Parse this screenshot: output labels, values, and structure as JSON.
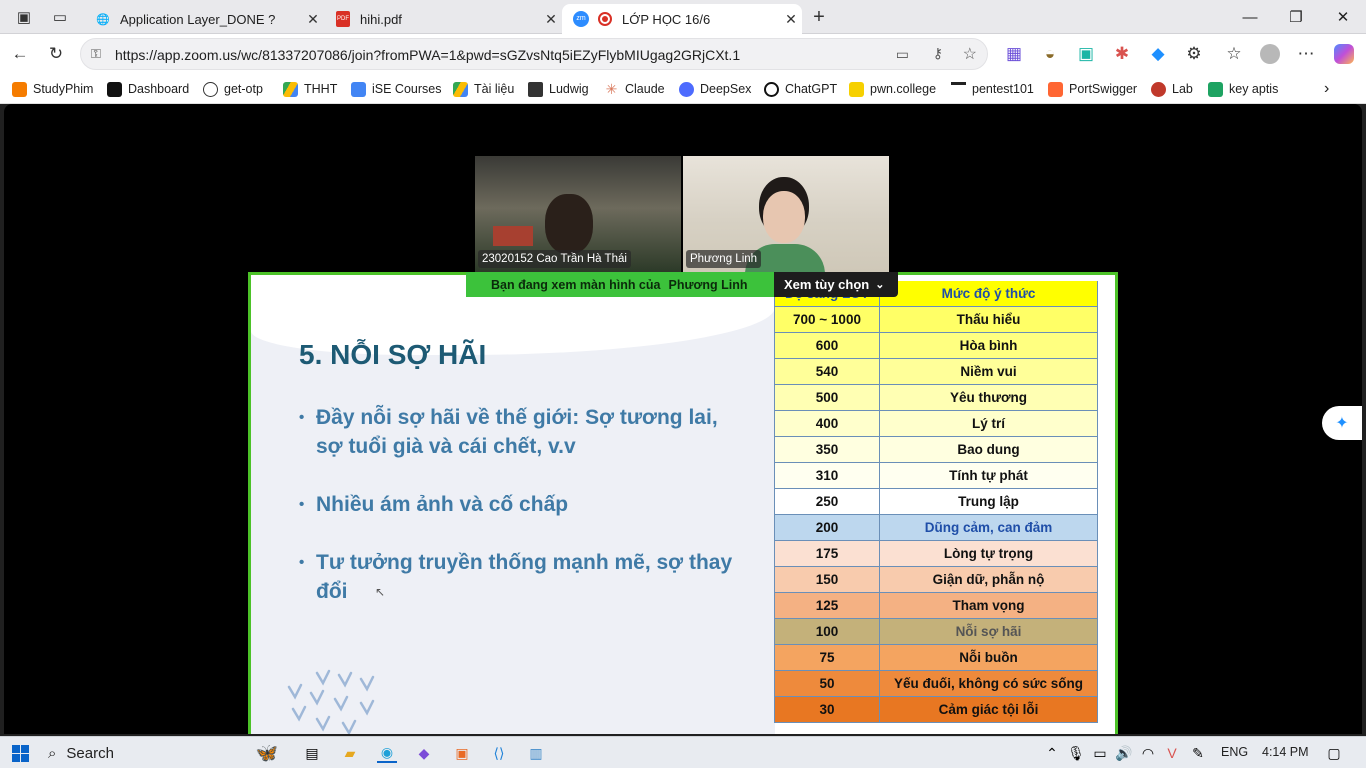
{
  "browser": {
    "tabs": [
      {
        "title": "Application Layer_DONE ?",
        "icon": "globe-icon"
      },
      {
        "title": "hihi.pdf",
        "icon": "pdf-icon"
      },
      {
        "title": "LỚP HỌC 16/6",
        "icon": "zoom-icon",
        "active": true
      }
    ],
    "url": "https://app.zoom.us/wc/81337207086/join?fromPWA=1&pwd=sGZvsNtq5iEZyFlybMIUgag2GRjCXt.1",
    "bookmarks": [
      "StudyPhim",
      "Dashboard",
      "get-otp",
      "THHT",
      "iSE Courses",
      "Tài liệu",
      "Ludwig",
      "Claude",
      "DeepSex",
      "ChatGPT",
      "pwn.college",
      "pentest101",
      "PortSwigger",
      "Lab",
      "key aptis"
    ]
  },
  "zoom": {
    "participants": [
      "23020152 Cao Trần Hà Thái",
      "Phương Linh"
    ],
    "share_banner": "Bạn đang xem màn hình của",
    "share_owner": "Phương Linh",
    "view_options": "Xem tùy chọn"
  },
  "slide": {
    "title": "5. NỖI SỢ HÃI",
    "bullets": [
      "Đầy nỗi sợ hãi về thế giới: Sợ tương lai, sợ tuổi già và cái chết, v.v",
      "Nhiều ám ảnh và cố chấp",
      "Tư tưởng truyền thống mạnh mẽ, sợ thay đổi"
    ],
    "table": {
      "headers": [
        "Độ sáng LOT",
        "Mức độ ý thức"
      ],
      "rows": [
        {
          "value": "700 ~ 1000",
          "label": "Thấu hiểu",
          "color": "#ffff66"
        },
        {
          "value": "600",
          "label": "Hòa bình",
          "color": "#ffff80"
        },
        {
          "value": "540",
          "label": "Niềm vui",
          "color": "#ffff99"
        },
        {
          "value": "500",
          "label": "Yêu thương",
          "color": "#ffffb3"
        },
        {
          "value": "400",
          "label": "Lý trí",
          "color": "#ffffcc"
        },
        {
          "value": "350",
          "label": "Bao dung",
          "color": "#ffffe0"
        },
        {
          "value": "310",
          "label": "Tính tự phát",
          "color": "#fffff0"
        },
        {
          "value": "250",
          "label": "Trung lập",
          "color": "#ffffff"
        },
        {
          "value": "200",
          "label": "Dũng cảm, can đảm",
          "color": "#bdd7ee",
          "text": "#1f4ea8"
        },
        {
          "value": "175",
          "label": "Lòng tự trọng",
          "color": "#fbe0d2"
        },
        {
          "value": "150",
          "label": "Giận dữ, phẫn nộ",
          "color": "#f8cbad"
        },
        {
          "value": "125",
          "label": "Tham vọng",
          "color": "#f4b183"
        },
        {
          "value": "100",
          "label": "Nỗi sợ hãi",
          "color": "#c4b17a",
          "text": "#555"
        },
        {
          "value": "75",
          "label": "Nỗi buồn",
          "color": "#f4a460"
        },
        {
          "value": "50",
          "label": "Yếu đuối, không có sức sống",
          "color": "#ee8a3c"
        },
        {
          "value": "30",
          "label": "Cảm giác tội lỗi",
          "color": "#e87722"
        }
      ]
    }
  },
  "taskbar": {
    "search": "Search",
    "lang": "ENG",
    "time": "4:14 PM"
  }
}
